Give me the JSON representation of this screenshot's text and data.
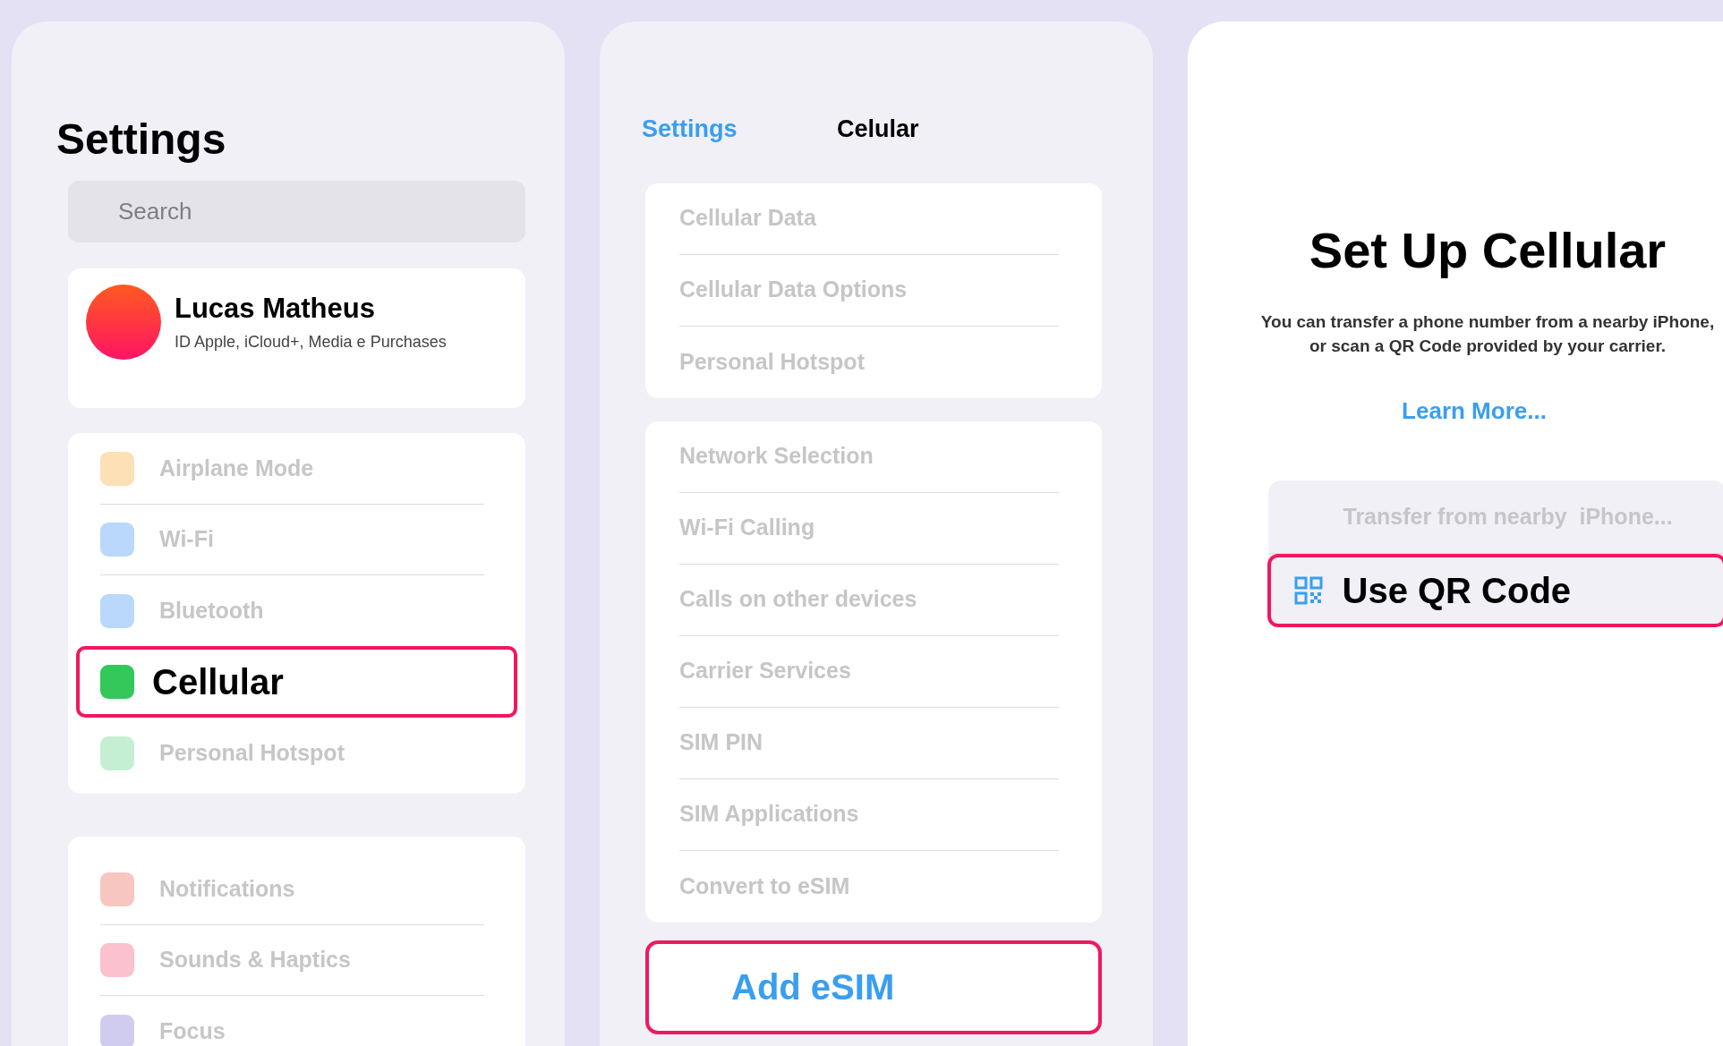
{
  "settings_panel": {
    "title": "Settings",
    "search": {
      "placeholder": "Search"
    },
    "profile": {
      "name": "Lucas Matheus",
      "subtitle": "ID Apple, iCloud+, Media e Purchases"
    },
    "groups": [
      {
        "items": [
          {
            "label": "Airplane Mode",
            "color": "#fde0b5",
            "selected": false
          },
          {
            "label": "Wi-Fi",
            "color": "#b9d8fb",
            "selected": false
          },
          {
            "label": "Bluetooth",
            "color": "#b9d8fb",
            "selected": false
          },
          {
            "label": "Cellular",
            "color": "#34c759",
            "selected": true
          },
          {
            "label": "Personal Hotspot",
            "color": "#c5efd2",
            "selected": false
          }
        ]
      },
      {
        "items": [
          {
            "label": "Notifications",
            "color": "#f8c6c1",
            "selected": false
          },
          {
            "label": "Sounds & Haptics",
            "color": "#fbc1ce",
            "selected": false
          },
          {
            "label": "Focus",
            "color": "#d0ccf0",
            "selected": false
          }
        ]
      }
    ]
  },
  "cellular_panel": {
    "back": "Settings",
    "title": "Celular",
    "groups": [
      {
        "items": [
          "Cellular Data",
          "Cellular Data Options",
          "Personal Hotspot"
        ]
      },
      {
        "items": [
          "Network Selection",
          "Wi-Fi Calling",
          "Calls on other devices",
          "Carrier Services",
          "SIM PIN",
          "SIM  Applications",
          "Convert to eSIM"
        ]
      }
    ],
    "add_button": {
      "label": "Add eSIM",
      "selected": true
    }
  },
  "setup_panel": {
    "title": "Set Up Cellular",
    "description": "You can transfer a phone number from a nearby iPhone, or scan a QR Code provided by your carrier.",
    "link": "Learn More...",
    "options": [
      {
        "kind": "transfer",
        "label": "Transfer from nearby  iPhone...",
        "selected": false
      },
      {
        "kind": "qr",
        "label": "Use QR Code",
        "selected": true
      }
    ]
  }
}
